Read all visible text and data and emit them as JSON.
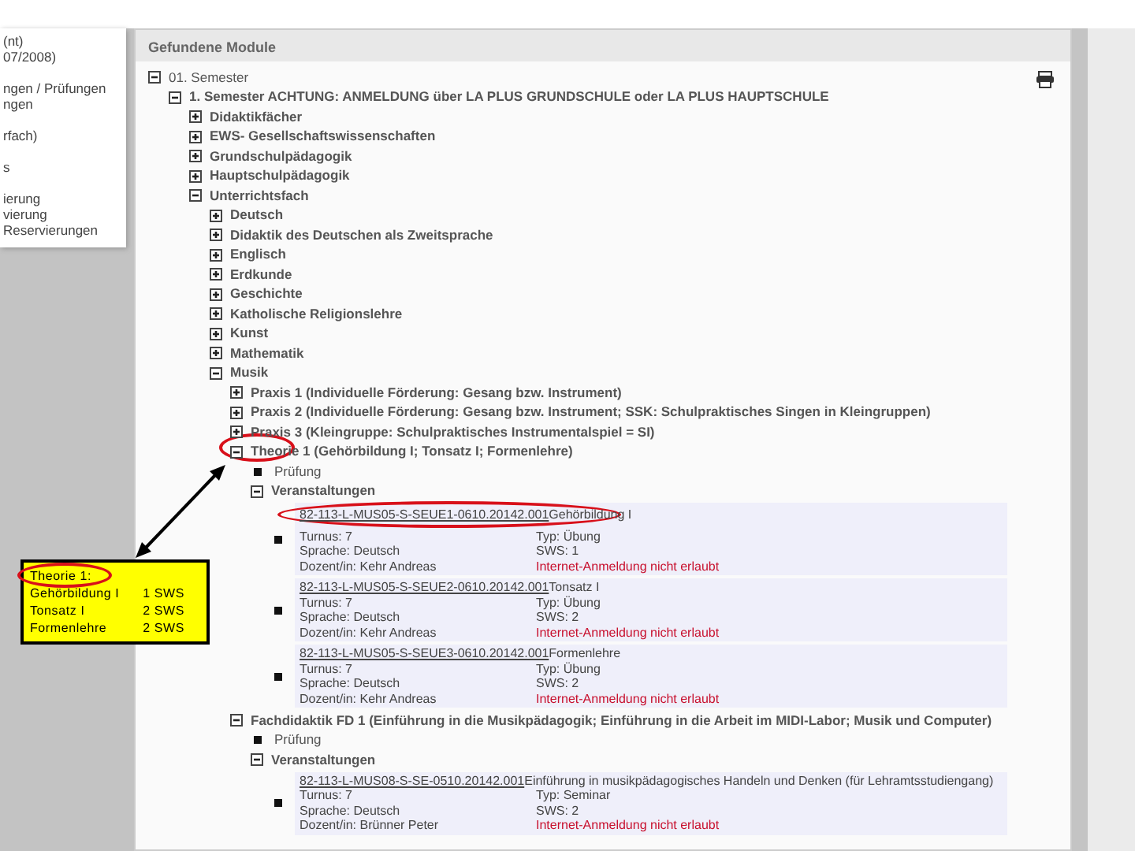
{
  "sidebar": {
    "groups": [
      [
        "(nt)",
        "07/2008)"
      ],
      [
        "ngen / Prüfungen",
        "ngen"
      ],
      [
        "rfach)"
      ],
      [
        "s"
      ],
      [
        "ierung",
        "vierung",
        "Reservierungen"
      ]
    ]
  },
  "panel": {
    "title": "Gefundene Module",
    "tree": [
      {
        "kind": "group",
        "label": "01. Semester",
        "expanded": true,
        "children": [
          {
            "kind": "group",
            "label": "1. Semester ACHTUNG: ANMELDUNG über LA PLUS GRUNDSCHULE oder LA PLUS HAUPTSCHULE",
            "expanded": true,
            "children": [
              {
                "kind": "group",
                "label": "Didaktikfächer",
                "expanded": false
              },
              {
                "kind": "group",
                "label": "EWS- Gesellschaftswissenschaften",
                "expanded": false
              },
              {
                "kind": "group",
                "label": "Grundschulpädagogik",
                "expanded": false
              },
              {
                "kind": "group",
                "label": "Hauptschulpädagogik",
                "expanded": false
              },
              {
                "kind": "group",
                "label": "Unterrichtsfach",
                "expanded": true,
                "children": [
                  {
                    "kind": "group",
                    "label": "Deutsch",
                    "expanded": false
                  },
                  {
                    "kind": "group",
                    "label": "Didaktik des Deutschen als Zweitsprache",
                    "expanded": false
                  },
                  {
                    "kind": "group",
                    "label": "Englisch",
                    "expanded": false
                  },
                  {
                    "kind": "group",
                    "label": "Erdkunde",
                    "expanded": false
                  },
                  {
                    "kind": "group",
                    "label": "Geschichte",
                    "expanded": false
                  },
                  {
                    "kind": "group",
                    "label": "Katholische Religionslehre",
                    "expanded": false
                  },
                  {
                    "kind": "group",
                    "label": "Kunst",
                    "expanded": false
                  },
                  {
                    "kind": "group",
                    "label": "Mathematik",
                    "expanded": false
                  },
                  {
                    "kind": "group",
                    "label": "Musik",
                    "expanded": true,
                    "children": [
                      {
                        "kind": "group",
                        "label": "Praxis 1 (Individuelle Förderung: Gesang bzw. Instrument)",
                        "expanded": false
                      },
                      {
                        "kind": "group",
                        "label": "Praxis 2 (Individuelle Förderung: Gesang bzw. Instrument; SSK: Schulpraktisches Singen in Kleingruppen)",
                        "expanded": false
                      },
                      {
                        "kind": "group",
                        "label": "Praxis 3 (Kleingruppe: Schulpraktisches Instrumentalspiel = SI)",
                        "expanded": false
                      },
                      {
                        "kind": "group",
                        "label": "Theorie 1 (Gehörbildung I; Tonsatz I; Formenlehre)",
                        "expanded": true,
                        "highlighted": true,
                        "children": [
                          {
                            "kind": "leaf",
                            "label": "Prüfung"
                          },
                          {
                            "kind": "group",
                            "label": "Veranstaltungen",
                            "expanded": true,
                            "children": [
                              {
                                "kind": "course",
                                "code": "82-113-L-MUS05-S-SEUE1-0610.20142.001",
                                "title": "Gehörbildung I",
                                "highlighted": true,
                                "turnus": "Turnus: 7",
                                "typ": "Typ: Übung",
                                "sprache": "Sprache: Deutsch",
                                "sws": "SWS: 1",
                                "dozent": "Dozent/in: Kehr Andreas",
                                "status": "Internet-Anmeldung nicht erlaubt"
                              },
                              {
                                "kind": "course",
                                "code": "82-113-L-MUS05-S-SEUE2-0610.20142.001",
                                "title": "Tonsatz I",
                                "turnus": "Turnus: 7",
                                "typ": "Typ: Übung",
                                "sprache": "Sprache: Deutsch",
                                "sws": "SWS: 2",
                                "dozent": "Dozent/in: Kehr Andreas",
                                "status": "Internet-Anmeldung nicht erlaubt"
                              },
                              {
                                "kind": "course",
                                "code": "82-113-L-MUS05-S-SEUE3-0610.20142.001",
                                "title": "Formenlehre",
                                "turnus": "Turnus: 7",
                                "typ": "Typ: Übung",
                                "sprache": "Sprache: Deutsch",
                                "sws": "SWS: 2",
                                "dozent": "Dozent/in: Kehr Andreas",
                                "status": "Internet-Anmeldung nicht erlaubt"
                              }
                            ]
                          }
                        ]
                      },
                      {
                        "kind": "group",
                        "label": "Fachdidaktik FD 1 (Einführung in die Musikpädagogik; Einführung in die Arbeit im MIDI-Labor; Musik und Computer)",
                        "expanded": true,
                        "children": [
                          {
                            "kind": "leaf",
                            "label": "Prüfung"
                          },
                          {
                            "kind": "group",
                            "label": "Veranstaltungen",
                            "expanded": true,
                            "children": [
                              {
                                "kind": "course",
                                "code": "82-113-L-MUS08-S-SE-0510.20142.001",
                                "title": "Einführung in musikpädagogisches Handeln und Denken (für Lehramtsstudiengang)",
                                "turnus": "Turnus: 7",
                                "typ": "Typ: Seminar",
                                "sprache": "Sprache: Deutsch",
                                "sws": "SWS: 2",
                                "dozent": "Dozent/in: Brünner Peter",
                                "status": "Internet-Anmeldung nicht erlaubt"
                              }
                            ]
                          }
                        ]
                      }
                    ]
                  }
                ]
              }
            ]
          }
        ]
      }
    ]
  },
  "annotation": {
    "lines": [
      {
        "label": "Theorie 1:",
        "highlighted": true
      },
      {
        "label": "Gehörbildung I",
        "value": "1 SWS"
      },
      {
        "label": "Tonsatz I",
        "value": "2 SWS"
      },
      {
        "label": "Formenlehre",
        "value": "2 SWS"
      }
    ]
  }
}
